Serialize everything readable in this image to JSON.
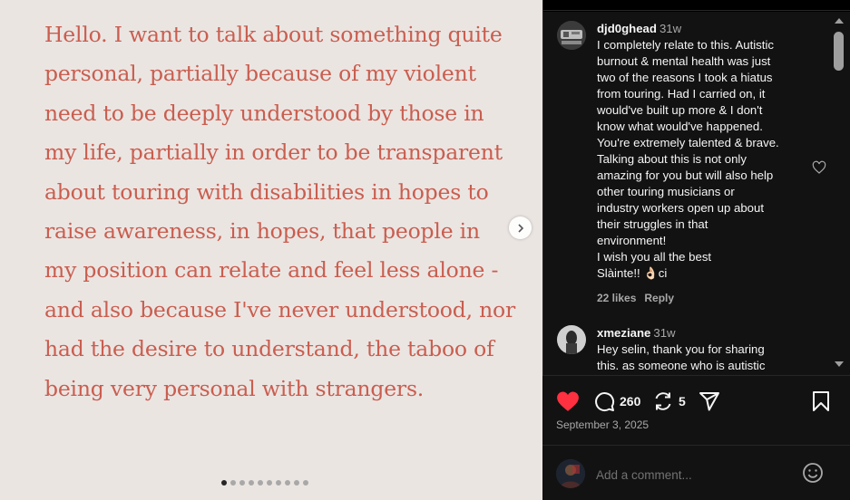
{
  "post": {
    "text": "Hello. I want to talk about something quite personal, partially because of my violent need to be deeply understood by those in my life, partially in order to be transparent about touring with disabilities in hopes to raise awareness, in hopes, that people in my position can relate and feel less alone - and also because I've never understood, nor had the desire to understand, the taboo of being very personal with strangers.",
    "slide_count": 10,
    "active_slide": 1,
    "colors": {
      "background": "#ebe5e2",
      "text": "#c95e4f"
    }
  },
  "comments": [
    {
      "username": "djd0ghead",
      "time": "31w",
      "lines": [
        "I completely relate to this. Autistic",
        "burnout & mental health was just",
        "two of the reasons I took a hiatus",
        "from touring. Had I carried on, it",
        "would've built up more & I don't",
        "know what would've happened.",
        "You're extremely talented & brave.",
        "Talking about this is not only",
        "amazing for you but will also help",
        "other touring musicians or",
        "industry workers open up about",
        "their struggles in that",
        "environment!",
        "I wish you all the best",
        "Slàinte!! 👌🏻ci"
      ],
      "likes": "22 likes",
      "reply": "Reply"
    },
    {
      "username": "xmeziane",
      "time": "31w",
      "lines": [
        "Hey selin, thank you for sharing",
        "this. as someone who is autistic"
      ]
    }
  ],
  "actions": {
    "comment_count": "260",
    "repost_count": "5",
    "like_color": "#ff3040"
  },
  "date": "September 3, 2025",
  "add_comment": {
    "placeholder": "Add a comment..."
  }
}
